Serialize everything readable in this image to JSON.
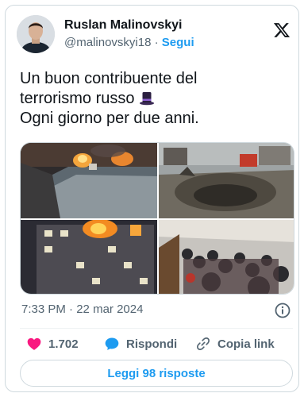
{
  "author": {
    "name": "Ruslan Malinovskyi",
    "handle": "@malinovskyi18",
    "separator": "·",
    "follow_label": "Segui"
  },
  "tweet": {
    "line1": "Un buon contribuente del",
    "line2": "terrorismo russo",
    "line3": "Ogni giorno per due anni.",
    "emoji_icon": "top-hat-icon"
  },
  "media": {
    "count": 4,
    "items": [
      "burning-dam-photo",
      "bomb-crater-photo",
      "burning-apartment-photo",
      "metro-shelter-crowd-photo"
    ]
  },
  "meta": {
    "time": "7:33 PM",
    "separator": "·",
    "date": "22 mar 2024"
  },
  "actions": {
    "likes": "1.702",
    "reply_label": "Rispondi",
    "copy_label": "Copia link"
  },
  "replies_button": "Leggi 98 risposte",
  "colors": {
    "accent": "#1d9bf0",
    "like": "#f91880",
    "muted": "#536471",
    "border": "#cfd9de"
  }
}
